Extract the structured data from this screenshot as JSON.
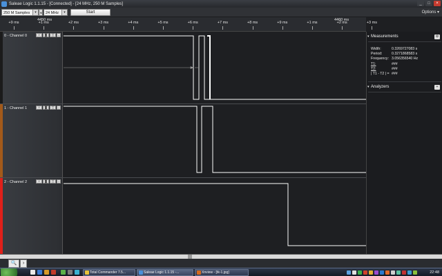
{
  "window": {
    "title": "Saleae Logic 1.1.15 - [Connected] - [24 MHz, 250 M Samples]",
    "min_glyph": "_",
    "max_glyph": "□",
    "close_glyph": "×"
  },
  "toolbar": {
    "samples_value": "250 M Samples",
    "rate_value": "24 MHz",
    "start_label": "Start",
    "options_label": "Options ▾",
    "arrow_glyph": "▾",
    "spin_glyph": "◂"
  },
  "timeline": {
    "marker_left": "4450 ms",
    "marker_right": "4460 ms",
    "ticks": [
      "+9 ms",
      "+1 ms",
      "+2 ms",
      "+3 ms",
      "+4 ms",
      "+5 ms",
      "+6 ms",
      "+7 ms",
      "+8 ms",
      "+9 ms",
      "+1 ms",
      "+2 ms",
      "+3 ms"
    ]
  },
  "channels": [
    {
      "label": "0 - Channel 0",
      "color": "#1b1b1b",
      "btn_f": "f",
      "btn_a": "▓",
      "btn_b": "▒",
      "btn_x": "–"
    },
    {
      "label": "1 - Channel 1",
      "color": "#a35a1a",
      "btn_f": "f",
      "btn_a": "▓",
      "btn_b": "▒",
      "btn_x": "–"
    },
    {
      "label": "2 - Channel 2",
      "color": "#e0201a",
      "btn_f": "f",
      "btn_a": "▓",
      "btn_b": "▒",
      "btn_x": "–"
    }
  ],
  "measurements": {
    "title": "Measurements",
    "gear_glyph": "⚙",
    "rows": [
      {
        "label": "Width:",
        "value": "0.3269727083 s"
      },
      {
        "label": "Period:",
        "value": "0.3271868583 s"
      },
      {
        "label": "Frequency:",
        "value": "3.056356540 Hz"
      },
      {
        "label": "T1:",
        "value": "###"
      },
      {
        "label": "T2:",
        "value": "###"
      },
      {
        "label": "| T1 - T2 | =",
        "value": "###"
      }
    ]
  },
  "analyzers": {
    "title": "Analyzers",
    "add_glyph": "+"
  },
  "bottom_tabs": {
    "search_glyph": "🔍",
    "second_glyph": "›"
  },
  "taskbar": {
    "tasks": [
      {
        "label": "Total Commander 7.5...",
        "color": "#e8c23a"
      },
      {
        "label": "Saleae Logic 1.1.15 -...",
        "color": "#4a90d9"
      },
      {
        "label": "Xnview - [tk-1.jpg]",
        "color": "#d46a1e"
      }
    ],
    "clock": "22:48"
  },
  "colors": {
    "signal": "#ffffff",
    "background": "#1e1f22",
    "accent_orange": "#a35a1a",
    "accent_red": "#e0201a"
  }
}
